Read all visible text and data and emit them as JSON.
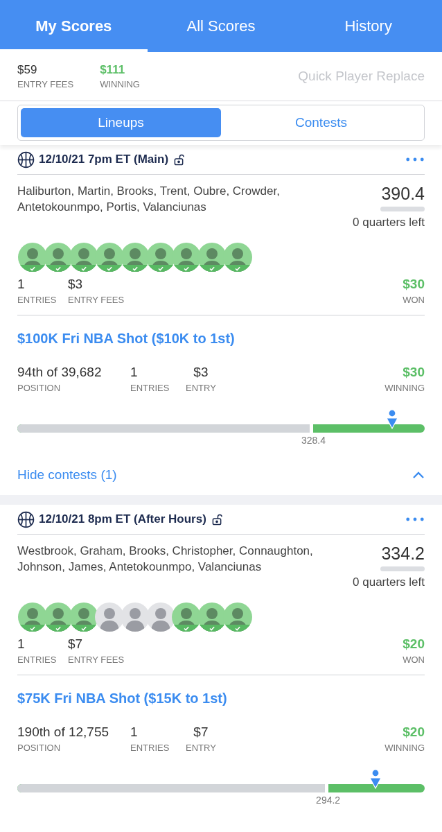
{
  "tabs": [
    {
      "label": "My Scores",
      "selected": true
    },
    {
      "label": "All Scores",
      "selected": false
    },
    {
      "label": "History",
      "selected": false
    }
  ],
  "summary": {
    "stats": [
      {
        "value": "$59",
        "label": "ENTRY FEES",
        "positive": false
      },
      {
        "value": "$111",
        "label": "WINNING",
        "positive": true
      }
    ],
    "action": "Quick Player Replace"
  },
  "segments": [
    {
      "label": "Lineups",
      "selected": true
    },
    {
      "label": "Contests",
      "selected": false
    }
  ],
  "lineups": [
    {
      "title": "12/10/21 7pm ET (Main)",
      "players": "Haliburton, Martin, Brooks, Trent, Oubre, Crowder, Antetokounmpo, Portis, Valanciunas",
      "score": "390.4",
      "quarters": "0 quarters left",
      "avatars": [
        {
          "finished": true
        },
        {
          "finished": true
        },
        {
          "finished": true
        },
        {
          "finished": true
        },
        {
          "finished": true
        },
        {
          "finished": true
        },
        {
          "finished": true
        },
        {
          "finished": true
        },
        {
          "finished": true
        }
      ],
      "stats": [
        {
          "value": "1",
          "label": "ENTRIES"
        },
        {
          "value": "$3",
          "label": "ENTRY FEES"
        }
      ],
      "won": {
        "value": "$30",
        "label": "WON"
      },
      "contests": [
        {
          "name": "$100K Fri NBA Shot ($10K to 1st)",
          "position": {
            "value": "94th of 39,682",
            "label": "POSITION"
          },
          "entries": {
            "value": "1",
            "label": "ENTRIES"
          },
          "entry": {
            "value": "$3",
            "label": "ENTRY"
          },
          "winning": {
            "value": "$30",
            "label": "WINNING"
          },
          "cutoff": {
            "label": "328.4",
            "level": 0.727
          },
          "marker": {
            "level": 0.92
          }
        }
      ],
      "toggle": {
        "label": "Hide contests (1)",
        "expanded": true
      }
    },
    {
      "title": "12/10/21 8pm ET (After Hours)",
      "players": "Westbrook, Graham, Brooks, Christopher, Connaughton, Johnson, James, Antetokounmpo, Valanciunas",
      "score": "334.2",
      "quarters": "0 quarters left",
      "avatars": [
        {
          "finished": true
        },
        {
          "finished": true
        },
        {
          "finished": true
        },
        {
          "finished": false
        },
        {
          "finished": false
        },
        {
          "finished": false
        },
        {
          "finished": true
        },
        {
          "finished": true
        },
        {
          "finished": true
        }
      ],
      "stats": [
        {
          "value": "1",
          "label": "ENTRIES"
        },
        {
          "value": "$7",
          "label": "ENTRY FEES"
        }
      ],
      "won": {
        "value": "$20",
        "label": "WON"
      },
      "contests": [
        {
          "name": "$75K Fri NBA Shot ($15K to 1st)",
          "position": {
            "value": "190th of 12,755",
            "label": "POSITION"
          },
          "entries": {
            "value": "1",
            "label": "ENTRIES"
          },
          "entry": {
            "value": "$7",
            "label": "ENTRY"
          },
          "winning": {
            "value": "$20",
            "label": "WINNING"
          },
          "cutoff": {
            "label": "294.2",
            "level": 0.763
          },
          "marker": {
            "level": 0.88
          }
        }
      ]
    }
  ]
}
